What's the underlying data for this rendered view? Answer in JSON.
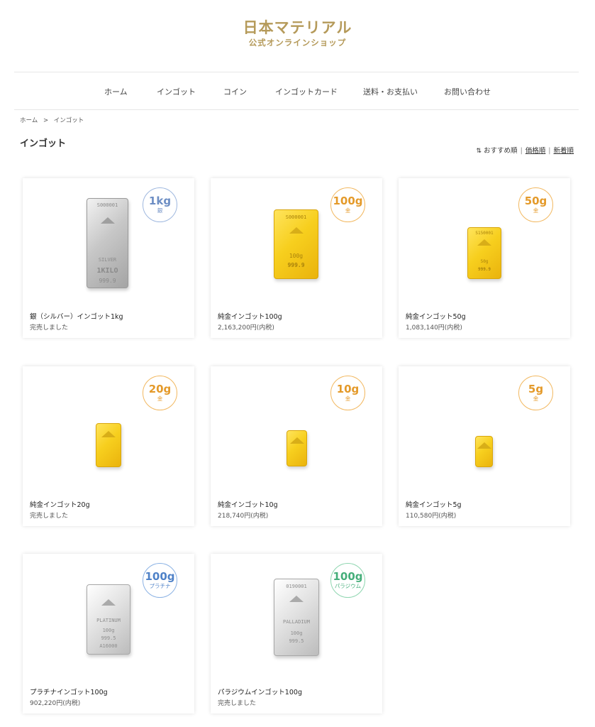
{
  "header": {
    "logo_main": "日本マテリアル",
    "logo_sub": "公式オンラインショップ"
  },
  "nav": {
    "items": [
      "ホーム",
      "インゴット",
      "コイン",
      "インゴットカード",
      "送料・お支払い",
      "お問い合わせ"
    ]
  },
  "breadcrumb": {
    "home": "ホーム",
    "separator": ">",
    "current": "インゴット"
  },
  "page": {
    "title": "インゴット"
  },
  "sort": {
    "icon": "sort-icon",
    "options": [
      "おすすめ順",
      "価格順",
      "新着順"
    ],
    "separator": "|"
  },
  "colors": {
    "brand": "#b59a5a",
    "gold_badge": "#e49a2a",
    "silver_badge": "#6d8ec4",
    "platinum_badge": "#4f82c8",
    "palladium_badge": "#45ae7a"
  },
  "products": [
    {
      "name": "銀（シルバー）インゴット1kg",
      "price": "完売しました",
      "badge_weight": "1kg",
      "badge_metal": "銀",
      "bar_stamps": [
        "S000001",
        "",
        "SILVER",
        "1KILO",
        "999.9"
      ]
    },
    {
      "name": "純金インゴット100g",
      "price": "2,163,200円(内税)",
      "badge_weight": "100g",
      "badge_metal": "金",
      "bar_stamps": [
        "S000001",
        "",
        "100g",
        "999.9"
      ]
    },
    {
      "name": "純金インゴット50g",
      "price": "1,083,140円(内税)",
      "badge_weight": "50g",
      "badge_metal": "金",
      "bar_stamps": [
        "S150001",
        "",
        "50g",
        "999.9"
      ]
    },
    {
      "name": "純金インゴット20g",
      "price": "完売しました",
      "badge_weight": "20g",
      "badge_metal": "金",
      "bar_stamps": [
        "",
        "",
        "",
        ""
      ]
    },
    {
      "name": "純金インゴット10g",
      "price": "218,740円(内税)",
      "badge_weight": "10g",
      "badge_metal": "金",
      "bar_stamps": [
        "",
        "",
        "",
        ""
      ]
    },
    {
      "name": "純金インゴット5g",
      "price": "110,580円(内税)",
      "badge_weight": "5g",
      "badge_metal": "金",
      "bar_stamps": [
        "",
        "",
        "",
        ""
      ]
    },
    {
      "name": "プラチナインゴット100g",
      "price": "902,220円(内税)",
      "badge_weight": "100g",
      "badge_metal": "プラチナ",
      "bar_stamps": [
        "",
        "PLATINUM",
        "100g",
        "999.5",
        "A16000"
      ]
    },
    {
      "name": "パラジウムインゴット100g",
      "price": "完売しました",
      "badge_weight": "100g",
      "badge_metal": "パラジウム",
      "bar_stamps": [
        "0190001",
        "",
        "PALLADIUM",
        "100g",
        "999.5"
      ]
    }
  ]
}
